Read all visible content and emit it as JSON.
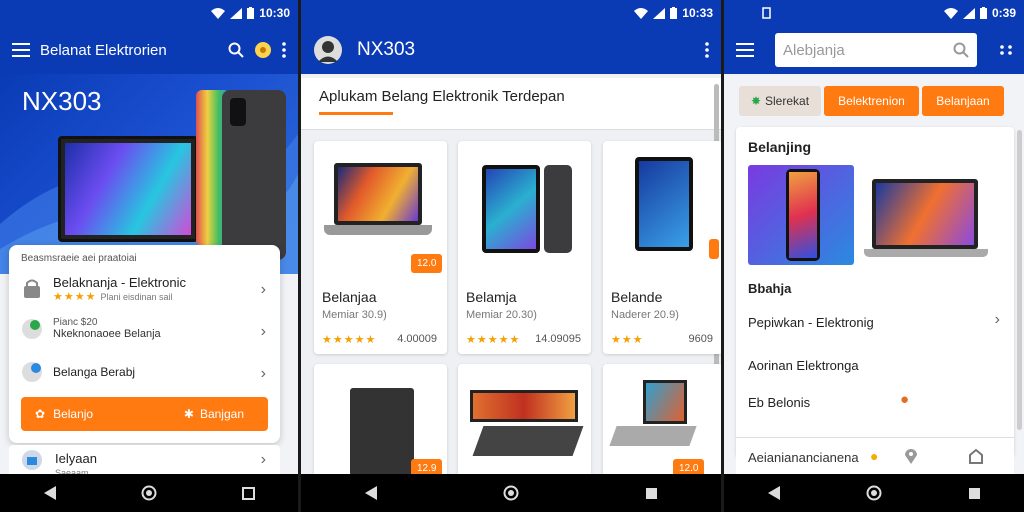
{
  "colors": {
    "primary": "#0a3bb5",
    "accent": "#ff7a10",
    "star": "#f5a000"
  },
  "screen1": {
    "status_time": "10:30",
    "title": "Belanat Elektrorien",
    "hero_title": "NX303",
    "card": {
      "header": "Beasmsraeie aei praatoiai",
      "rows": [
        {
          "title": "Belaknanja - Elektronic",
          "sub": "Plani eisdinan sail",
          "stars": "★★★★"
        },
        {
          "title": "Pianc $20",
          "sub": "Nkeknonaoee Belanja"
        },
        {
          "title": "Belanga Berabj"
        }
      ],
      "button_left": "Belanjo",
      "button_right": "Banjgan"
    },
    "bottom_row": {
      "title": "Ielyaan",
      "sub": "Saeaam"
    }
  },
  "screen2": {
    "status_time": "10:33",
    "title": "NX303",
    "subtitle": "Aplukam Belang Elektronik  Terdepan",
    "products": [
      {
        "name": "Belanjaa",
        "meta": "Memiar 30.9)",
        "stars": "★★★★★",
        "price": "4.00009"
      },
      {
        "name": "Belamja",
        "meta": "Memiar 20.30)",
        "stars": "★★★★★",
        "price": "14.09095"
      },
      {
        "name": "Belande",
        "meta": "Naderer 20.9)",
        "stars": "★★★",
        "price": "9609"
      }
    ],
    "badges": [
      "12.0",
      "12.9",
      "12.0"
    ]
  },
  "screen3": {
    "status_time": "0:39",
    "search_placeholder": "Alebjanja",
    "chips": [
      "Slerekat",
      "Belektrenion",
      "Belanjaan"
    ],
    "section1": "Belanjing",
    "section2": "Bbahja",
    "items": [
      "Pepiwkan - Elektronig",
      "Aorinan Elektronga",
      "Eb Belonis"
    ],
    "footer": "Aeianianancianena"
  }
}
